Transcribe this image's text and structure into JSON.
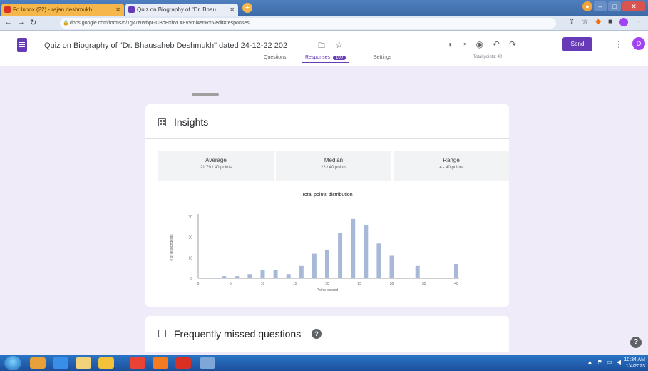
{
  "browser": {
    "tabs": [
      {
        "label": "Fc Inbox (22) - rajan.deshmukh..."
      },
      {
        "label": "Quiz on Biography of \"Dr. Bhau..."
      }
    ],
    "url": "docs.google.com/forms/d/1gk7NWbpGCBdHxbvLX8V9ml4e6Rx5/edit#responses"
  },
  "header": {
    "form_title": "Quiz on Biography of \"Dr. Bhausaheb Deshmukh\" dated 24-12-22 202",
    "send_label": "Send",
    "avatar_initial": "D",
    "nav": {
      "questions": "Questions",
      "responses": "Responses",
      "response_count": "100",
      "settings": "Settings",
      "total_points": "Total points: 40"
    }
  },
  "insights": {
    "title": "Insights",
    "stats": {
      "average_label": "Average",
      "average_value": "21.79 / 40 points",
      "median_label": "Median",
      "median_value": "22 / 40 points",
      "range_label": "Range",
      "range_value": "4 - 40 points"
    }
  },
  "chart_data": {
    "type": "bar",
    "title": "Total points distribution",
    "xlabel": "Points scored",
    "ylabel": "# of respondents",
    "x": [
      4,
      6,
      8,
      10,
      12,
      14,
      16,
      18,
      20,
      22,
      24,
      26,
      28,
      30,
      34,
      40
    ],
    "values": [
      1,
      1,
      2,
      4,
      4,
      2,
      6,
      12,
      14,
      22,
      29,
      26,
      17,
      11,
      6,
      7
    ],
    "xlim": [
      0,
      40
    ],
    "ylim": [
      0,
      30
    ],
    "xticks": [
      "0",
      "5",
      "10",
      "15",
      "20",
      "25",
      "30",
      "35",
      "40"
    ],
    "yticks": [
      "0",
      "10",
      "20",
      "30"
    ],
    "color": "#a7b9d7"
  },
  "missed": {
    "title": "Frequently missed questions"
  },
  "taskbar": {
    "time": "10:34 AM",
    "date": "1/4/2023"
  }
}
